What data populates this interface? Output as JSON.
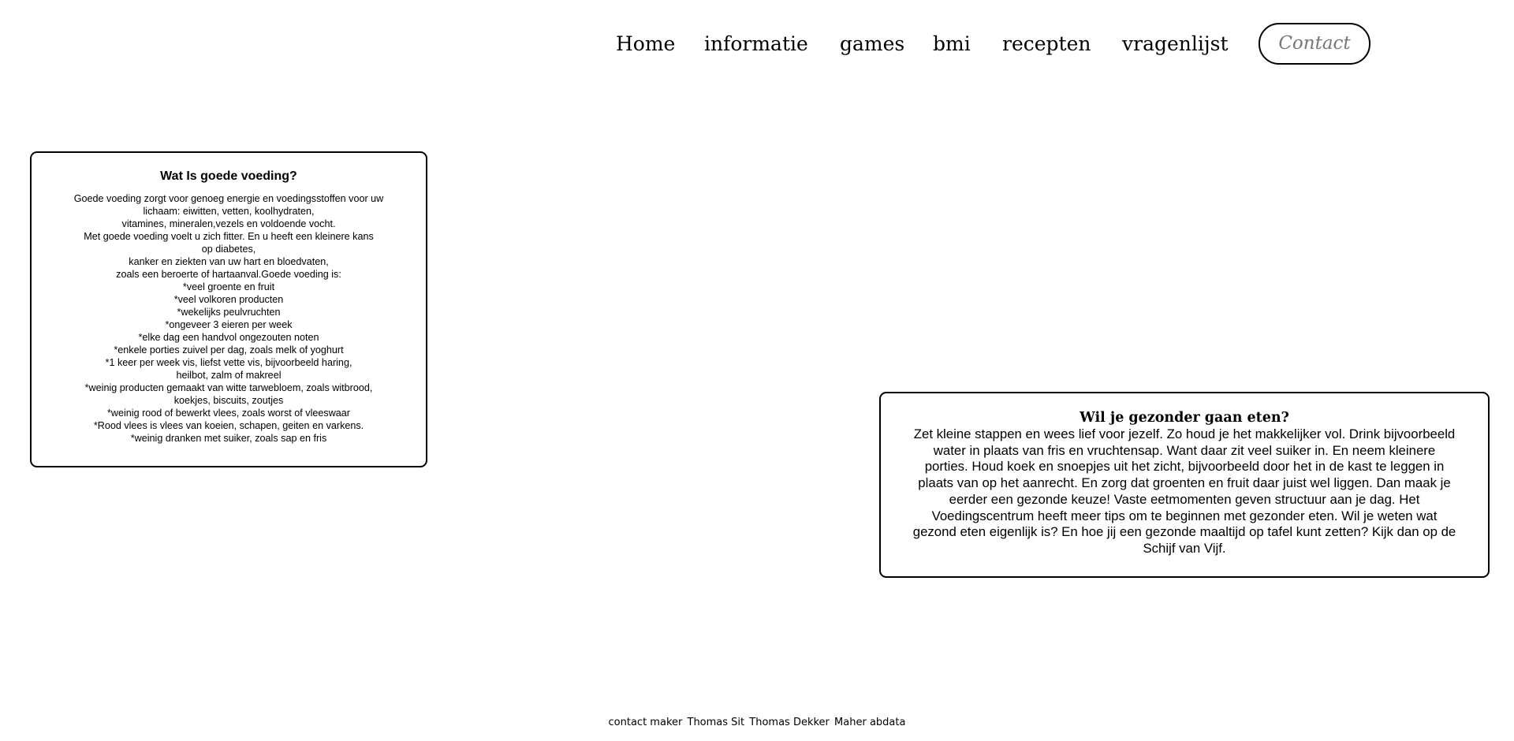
{
  "nav": {
    "items": [
      {
        "label": "Home"
      },
      {
        "label": "informatie"
      },
      {
        "label": "games"
      },
      {
        "label": "bmi"
      },
      {
        "label": "recepten"
      },
      {
        "label": "vragenlijst"
      }
    ],
    "contact_label": "Contact"
  },
  "left_card": {
    "title": "Wat Is goede voeding?",
    "lines": [
      "Goede voeding zorgt voor genoeg energie en voedingsstoffen voor uw",
      "lichaam: eiwitten, vetten, koolhydraten,",
      "vitamines, mineralen,vezels en voldoende vocht.",
      "Met goede voeding voelt u zich fitter. En u heeft een kleinere kans",
      "op diabetes,",
      "kanker en ziekten van uw hart en bloedvaten,",
      "zoals een beroerte of hartaanval.Goede voeding is:",
      "*veel groente en fruit",
      "*veel volkoren producten",
      "*wekelijks peulvruchten",
      "*ongeveer 3 eieren per week",
      "*elke dag een handvol ongezouten noten",
      "*enkele porties zuivel per dag, zoals melk of yoghurt",
      "*1 keer per week vis, liefst vette vis, bijvoorbeeld haring,",
      "heilbot, zalm of makreel",
      "*weinig producten gemaakt van witte tarwebloem, zoals witbrood,",
      "koekjes, biscuits, zoutjes",
      "*weinig rood of bewerkt vlees, zoals worst of vleeswaar",
      "*Rood vlees is vlees van koeien, schapen, geiten en varkens.",
      "*weinig dranken met suiker, zoals sap en fris"
    ]
  },
  "right_card": {
    "title": "Wil je gezonder gaan eten?",
    "lines": [
      "Zet kleine stappen en wees lief voor jezelf. Zo houd je het makkelijker vol. Drink bijvoorbeeld",
      "water in plaats van fris en vruchtensap. Want daar zit veel suiker in. En neem kleinere",
      "porties. Houd koek en snoepjes uit het zicht, bijvoorbeeld door het in de kast te leggen in",
      "plaats van op het aanrecht. En zorg dat groenten en fruit daar juist wel liggen. Dan maak je",
      "eerder een gezonde keuze! Vaste eetmomenten geven structuur aan je dag. Het",
      "Voedingscentrum heeft meer tips om te beginnen met gezonder eten. Wil je weten wat",
      "gezond eten eigenlijk is? En hoe jij een gezonde maaltijd op tafel kunt zetten? Kijk dan op de",
      "Schijf van Vijf."
    ]
  },
  "footer": {
    "label": "contact maker",
    "names": [
      "Thomas Sit",
      "Thomas Dekker",
      "Maher abdata"
    ]
  }
}
